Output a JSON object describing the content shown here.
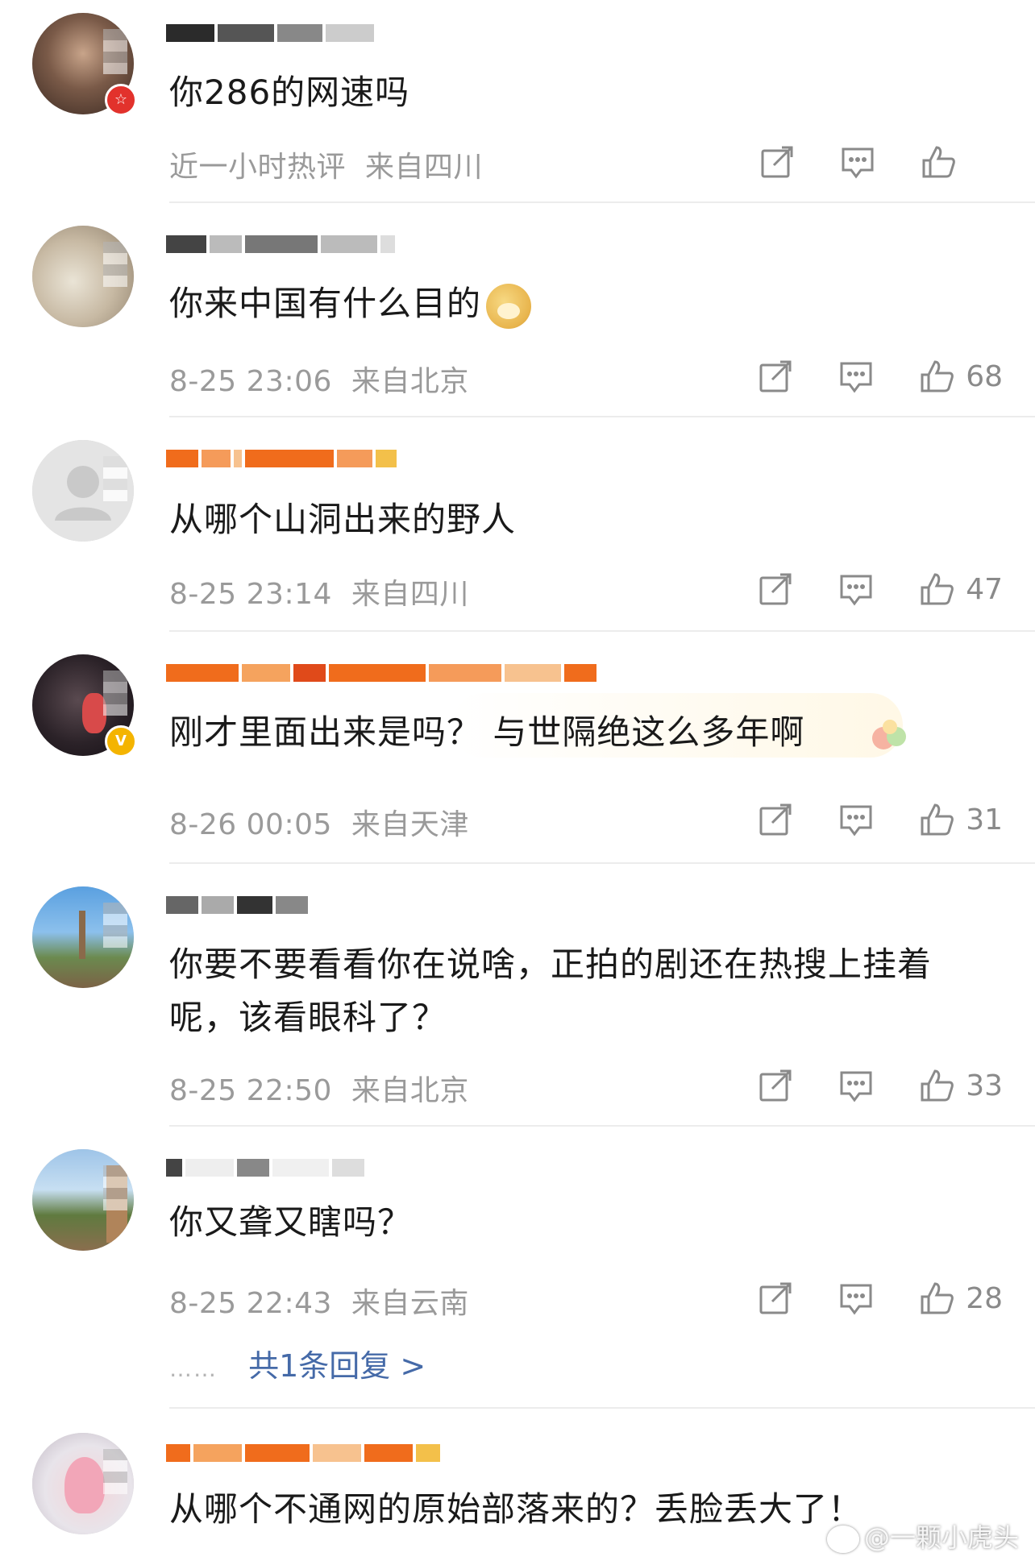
{
  "comments": [
    {
      "text": "你286的网速吗",
      "time": "近一小时热评",
      "location": "来自四川",
      "likes": "",
      "avatar_badge": "red-star",
      "username_colors": [
        "#2b2b2b",
        "#555555",
        "#888888"
      ]
    },
    {
      "text": "你来中国有什么目的",
      "emoji": "doge-emoji",
      "time": "8-25 23:06",
      "location": "来自北京",
      "likes": "68",
      "username_colors": [
        "#444444",
        "#777777",
        "#bbbbbb"
      ]
    },
    {
      "text": "从哪个山洞出来的野人",
      "time": "8-25 23:14",
      "location": "来自四川",
      "likes": "47",
      "username_colors": [
        "#f06c1c",
        "#f59b5a",
        "#f7c28f"
      ]
    },
    {
      "text": "刚才里面出来是吗？ 与世隔绝这么多年啊",
      "time": "8-26 00:05",
      "location": "来自天津",
      "likes": "31",
      "avatar_badge": "gold-v",
      "username_colors": [
        "#f06c1c",
        "#e04a1a",
        "#f7c28f"
      ]
    },
    {
      "text": "你要不要看看你在说啥，正拍的剧还在热搜上挂着呢，该看眼科了？",
      "time": "8-25 22:50",
      "location": "来自北京",
      "likes": "33",
      "username_colors": [
        "#333333",
        "#666666",
        "#aaaaaa"
      ]
    },
    {
      "text": "你又聋又瞎吗？",
      "time": "8-25 22:43",
      "location": "来自云南",
      "likes": "28",
      "replies_label": "共1条回复 >",
      "replies_dots": "……",
      "username_colors": [
        "#444444",
        "#888888",
        "#cccccc"
      ]
    },
    {
      "text": "从哪个不通网的原始部落来的？丢脸丢大了！",
      "time": "",
      "location": "",
      "likes": "",
      "username_colors": [
        "#f06c1c",
        "#f5a35e",
        "#f3c04a"
      ]
    }
  ],
  "watermark": "@一颗小虎头",
  "colors": {
    "text": "#1a1a1a",
    "meta": "#9a9a9a",
    "link": "#456aa8",
    "divider": "#ececec",
    "icon": "#8a8a8a"
  },
  "icons": {
    "share": "share-icon",
    "reply": "comment-icon",
    "like": "thumbs-up-icon"
  }
}
